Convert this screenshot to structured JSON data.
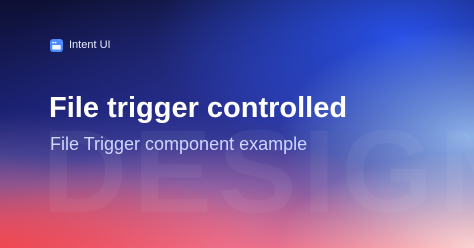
{
  "brand": {
    "name": "Intent UI",
    "icon": "app-window-icon",
    "icon_color": "#4b8bff"
  },
  "hero": {
    "title": "File trigger controlled",
    "subtitle": "File Trigger component example",
    "watermark": "DESIGN"
  },
  "colors": {
    "background_top": "#0d1033",
    "background_blue": "#2850e6",
    "background_bottom_left": "#ee4650",
    "background_bottom_right": "#ffe6e1",
    "title": "#ffffff",
    "subtitle": "#cdd6ff"
  }
}
